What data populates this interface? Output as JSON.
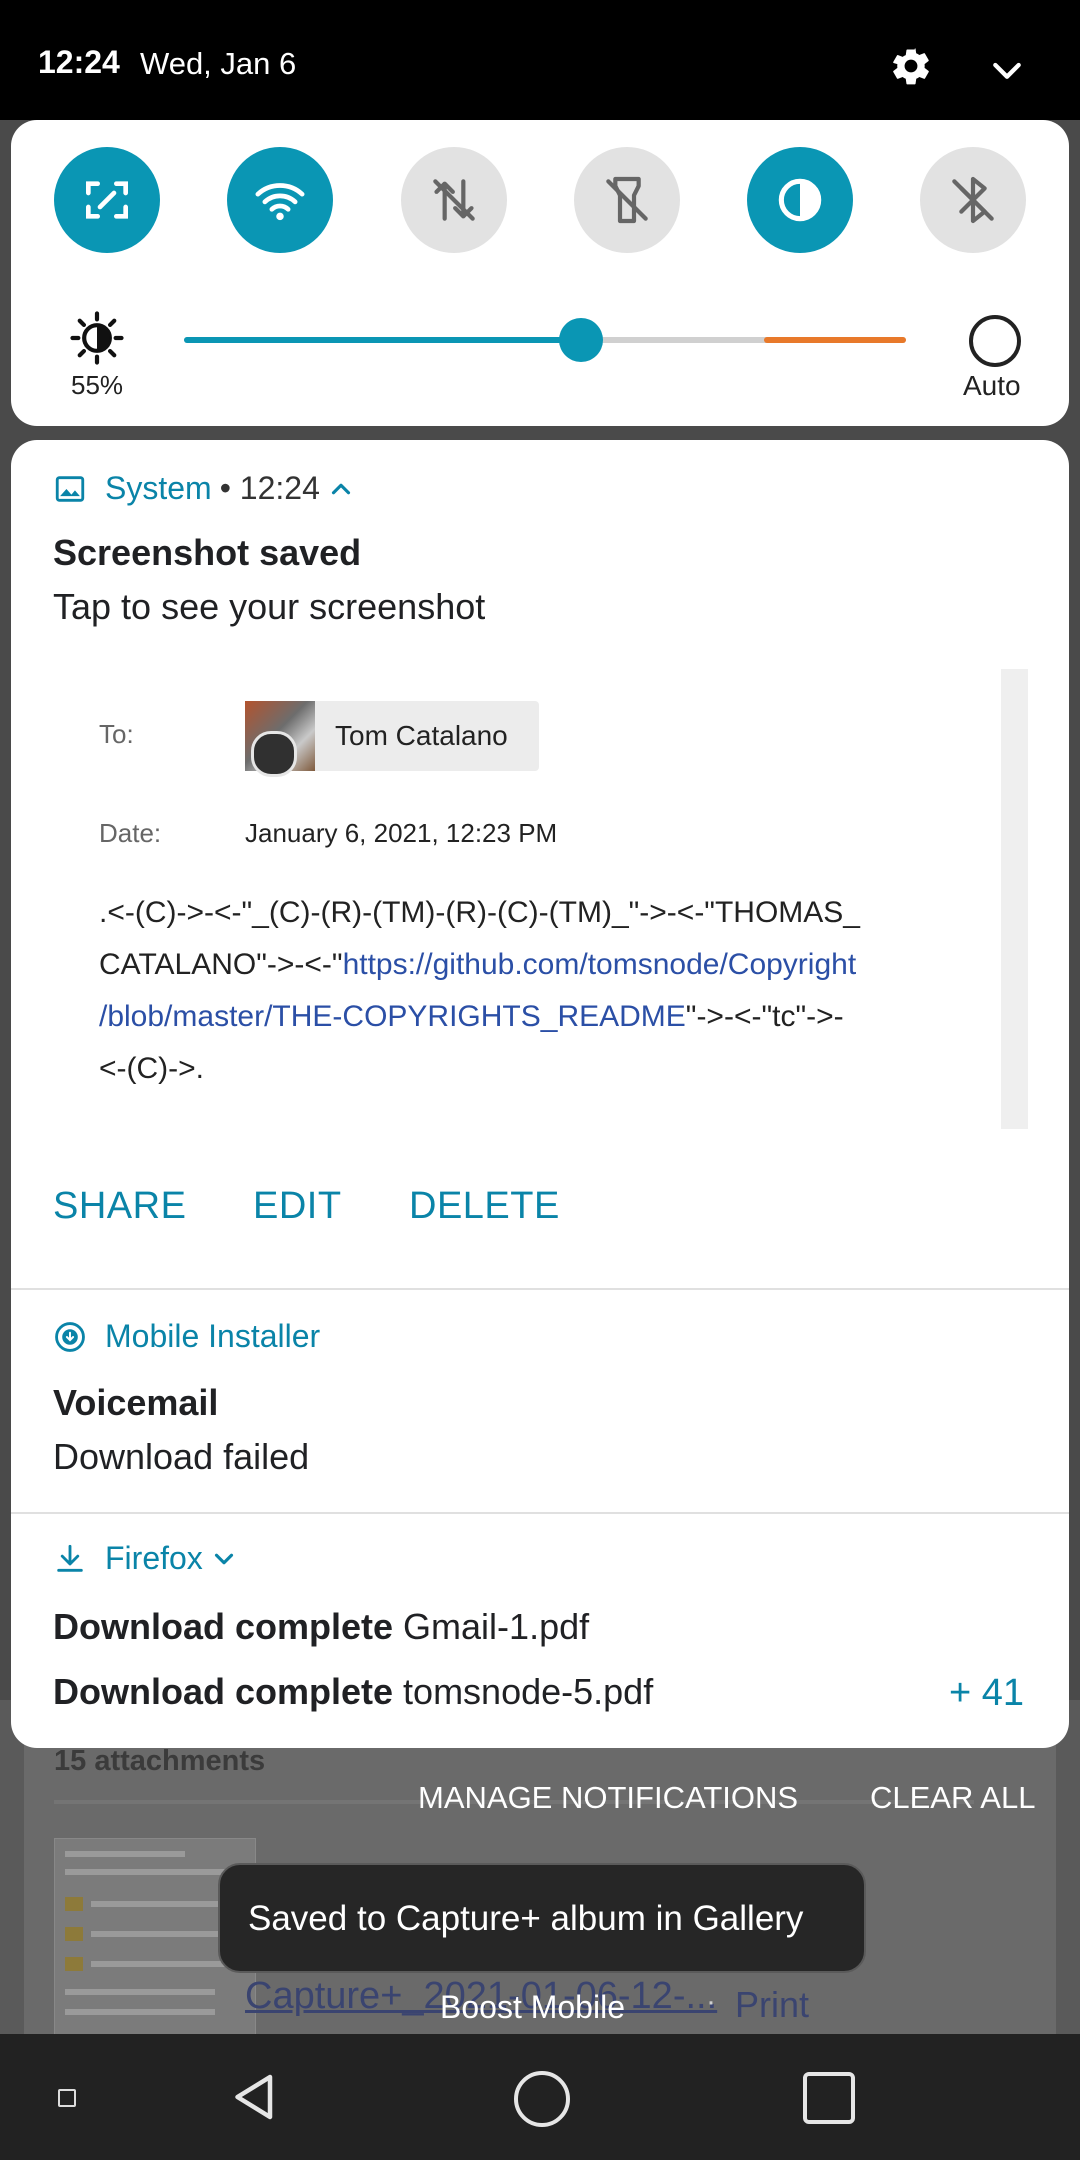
{
  "status_bar": {
    "time": "12:24",
    "date": "Wed, Jan 6"
  },
  "quick_settings": {
    "tiles": [
      {
        "icon": "screen-expand-icon",
        "on": true
      },
      {
        "icon": "wifi-icon",
        "on": true
      },
      {
        "icon": "mobile-data-off-icon",
        "on": false
      },
      {
        "icon": "flashlight-off-icon",
        "on": false
      },
      {
        "icon": "invert-colors-icon",
        "on": true
      },
      {
        "icon": "bluetooth-off-icon",
        "on": false
      }
    ],
    "brightness": {
      "percent_label": "55%",
      "level": 0.55,
      "auto_label": "Auto"
    }
  },
  "notifications": {
    "screenshot": {
      "app": "System",
      "time": "• 12:24",
      "title": "Screenshot saved",
      "text": "Tap to see your screenshot",
      "preview": {
        "to_label": "To:",
        "recipient": "Tom Catalano",
        "date_label": "Date:",
        "date": "January 6, 2021, 12:23 PM",
        "body_line1": ".<-(C)->-<-\"_(C)-(R)-(TM)-(R)-(C)-(TM)_\"->-<-\"THOMAS_",
        "body_line2_pre": "CATALANO\"->-<-\"",
        "body_link_a": "https://github.com/tomsnode/Copyright",
        "body_link_b": "/blob/master/THE-COPYRIGHTS_README",
        "body_line3_post": "\"->-<-\"tc\"->-",
        "body_line4": "<-(C)->."
      },
      "actions": [
        "SHARE",
        "EDIT",
        "DELETE"
      ]
    },
    "installer": {
      "app": "Mobile Installer",
      "title": "Voicemail",
      "text": "Download failed"
    },
    "firefox": {
      "app": "Firefox",
      "line1_bold": "Download complete",
      "line1_file": "Gmail-1.pdf",
      "line2_bold": "Download complete",
      "line2_file": "tomsnode-5.pdf",
      "more_count": "+ 41"
    }
  },
  "footer": {
    "manage_label": "MANAGE NOTIFICATIONS",
    "clear_label": "CLEAR ALL",
    "toast": "Saved to Capture+ album in Gallery",
    "carrier": "Boost Mobile"
  },
  "background": {
    "attachments_label": "15 attachments",
    "file_link": "Capture+_2021-01-06-12-...",
    "print_label": "Print"
  }
}
